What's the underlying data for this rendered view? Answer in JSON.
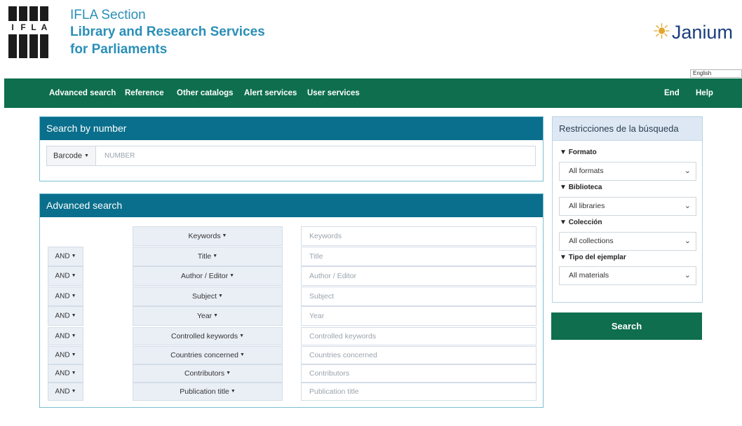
{
  "header": {
    "logo_letters": [
      "I",
      "F",
      "L",
      "A"
    ],
    "section_line1": "IFLA Section",
    "section_line2": "Library and Research Services",
    "section_line3": "for Parliaments",
    "partner_logo": "Janium",
    "partner_icon": "sun-icon",
    "language": "English"
  },
  "nav": {
    "items": [
      "Advanced search",
      "Reference",
      "Other catalogs",
      "Alert services",
      "User services"
    ],
    "right_items": [
      "End",
      "Help"
    ],
    "background_color": "#0e6e4e"
  },
  "search_by_number": {
    "title": "Search by number",
    "type_label": "Barcode",
    "placeholder": "NUMBER"
  },
  "advanced_search": {
    "title": "Advanced search",
    "rows": [
      {
        "op": "",
        "field": "Keywords",
        "placeholder": "Keywords"
      },
      {
        "op": "AND",
        "field": "Title",
        "placeholder": "Title"
      },
      {
        "op": "AND",
        "field": "Author / Editor",
        "placeholder": "Author / Editor"
      },
      {
        "op": "AND",
        "field": "Subject",
        "placeholder": "Subject"
      },
      {
        "op": "AND",
        "field": "Year",
        "placeholder": "Year"
      },
      {
        "op": "AND",
        "field": "Controlled keywords",
        "placeholder": "Controlled keywords"
      },
      {
        "op": "AND",
        "field": "Countries concerned",
        "placeholder": "Countries concerned"
      },
      {
        "op": "AND",
        "field": "Contributors",
        "placeholder": "Contributors"
      },
      {
        "op": "AND",
        "field": "Publication title",
        "placeholder": "Publication title"
      }
    ],
    "header_color": "#0a6f8c"
  },
  "restrictions": {
    "title": "Restricciones de la búsqueda",
    "filters": [
      {
        "label": "Formato",
        "value": "All formats"
      },
      {
        "label": "Biblioteca",
        "value": "All libraries"
      },
      {
        "label": "Colección",
        "value": "All collections"
      },
      {
        "label": "Tipo del ejemplar",
        "value": "All materials"
      }
    ],
    "search_label": "Search"
  },
  "colors": {
    "brand_blue": "#2a8fb8",
    "janium_blue": "#1a3e7e",
    "janium_gold": "#e2a72d"
  },
  "icons": {
    "caret": "caret-down-icon",
    "filter": "funnel-icon",
    "chevron": "chevron-down-icon"
  }
}
